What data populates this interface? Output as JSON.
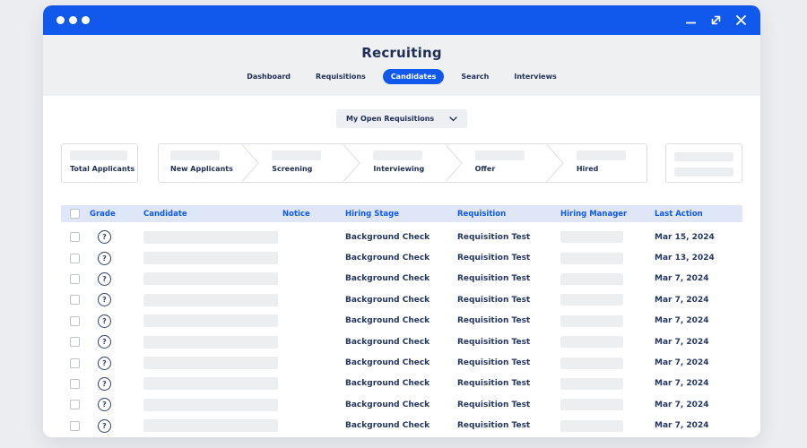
{
  "colors": {
    "accent": "#1059EC",
    "titlebar": "#1059EC",
    "header_bg": "#EFF0F2",
    "table_header_bg": "#DEE6F8",
    "table_header_text": "#1059EC",
    "text_dark": "#1F2E55",
    "placeholder": "#EDEEF0"
  },
  "titlebar": {
    "controls": [
      "minimize",
      "resize",
      "close"
    ]
  },
  "header": {
    "title": "Recruiting",
    "tabs": [
      {
        "label": "Dashboard",
        "active": false
      },
      {
        "label": "Requisitions",
        "active": false
      },
      {
        "label": "Candidates",
        "active": true
      },
      {
        "label": "Search",
        "active": false
      },
      {
        "label": "Interviews",
        "active": false
      }
    ]
  },
  "filter": {
    "label": "My Open Requisitions"
  },
  "pipeline": {
    "total_label": "Total Applicants",
    "stages": [
      "New Applicants",
      "Screening",
      "Interviewing",
      "Offer",
      "Hired"
    ]
  },
  "table": {
    "columns": [
      "Grade",
      "Candidate",
      "Notice",
      "Hiring Stage",
      "Requisition",
      "Hiring Manager",
      "Last Action"
    ],
    "select_all_checked": false,
    "rows": [
      {
        "grade": "?",
        "hiring_stage": "Background Check",
        "requisition": "Requisition Test",
        "last_action": "Mar 15, 2024"
      },
      {
        "grade": "?",
        "hiring_stage": "Background Check",
        "requisition": "Requisition Test",
        "last_action": "Mar 13, 2024"
      },
      {
        "grade": "?",
        "hiring_stage": "Background Check",
        "requisition": "Requisition Test",
        "last_action": "Mar 7, 2024"
      },
      {
        "grade": "?",
        "hiring_stage": "Background Check",
        "requisition": "Requisition Test",
        "last_action": "Mar 7, 2024"
      },
      {
        "grade": "?",
        "hiring_stage": "Background Check",
        "requisition": "Requisition Test",
        "last_action": "Mar 7, 2024"
      },
      {
        "grade": "?",
        "hiring_stage": "Background Check",
        "requisition": "Requisition Test",
        "last_action": "Mar 7, 2024"
      },
      {
        "grade": "?",
        "hiring_stage": "Background Check",
        "requisition": "Requisition Test",
        "last_action": "Mar 7, 2024"
      },
      {
        "grade": "?",
        "hiring_stage": "Background Check",
        "requisition": "Requisition Test",
        "last_action": "Mar 7, 2024"
      },
      {
        "grade": "?",
        "hiring_stage": "Background Check",
        "requisition": "Requisition Test",
        "last_action": "Mar 7, 2024"
      },
      {
        "grade": "?",
        "hiring_stage": "Background Check",
        "requisition": "Requisition Test",
        "last_action": "Mar 7, 2024"
      }
    ]
  }
}
